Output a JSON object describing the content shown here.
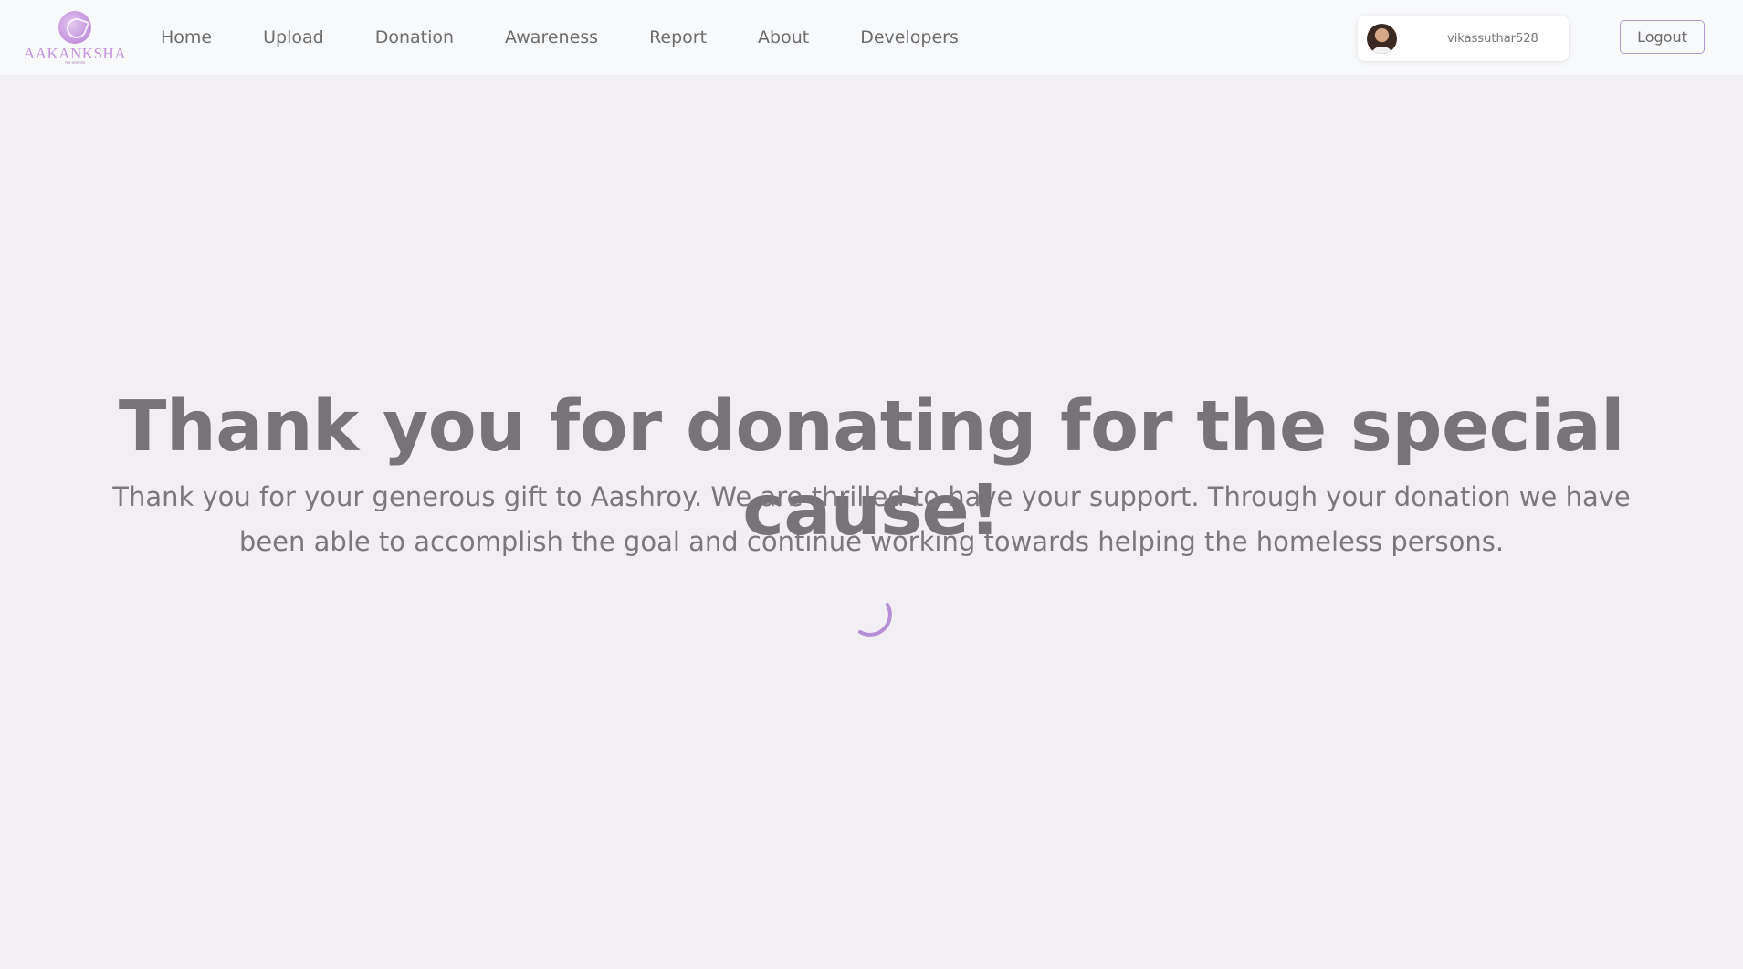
{
  "navbar": {
    "logo_text": "AAKANKSHA",
    "logo_subtext": "स्वप्न आशा पंख",
    "links": [
      {
        "label": "Home"
      },
      {
        "label": "Upload"
      },
      {
        "label": "Donation"
      },
      {
        "label": "Awareness"
      },
      {
        "label": "Report"
      },
      {
        "label": "About"
      },
      {
        "label": "Developers"
      }
    ],
    "user": {
      "username": "vikassuthar528"
    },
    "logout_label": "Logout"
  },
  "main": {
    "title": "Thank you for donating for the special cause!",
    "message": "Thank you for your generous gift to Aashroy. We are thrilled to have your support. Through your donation we have been able to accomplish the goal and continue working towards helping the homeless persons."
  },
  "colors": {
    "background": "#f2eff4",
    "accent": "#b597cf",
    "spinner": "#b48fd6"
  }
}
